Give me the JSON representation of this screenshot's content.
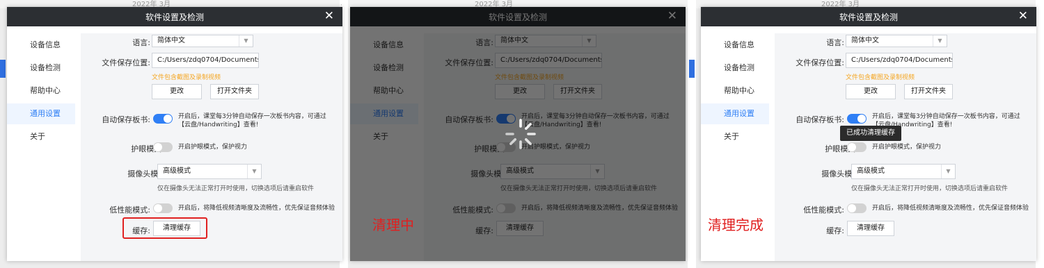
{
  "background": {
    "date_text": "2022年 3月"
  },
  "dialog": {
    "title": "软件设置及检测",
    "close_glyph": "✕",
    "nav": [
      {
        "label": "设备信息"
      },
      {
        "label": "设备检测"
      },
      {
        "label": "帮助中心"
      },
      {
        "label": "通用设置",
        "active": true
      },
      {
        "label": "关于"
      }
    ],
    "settings": {
      "language": {
        "label": "语言:",
        "value": "简体中文"
      },
      "save_path": {
        "label": "文件保存位置:",
        "value": "C:/Users/zdq0704/Documents/...",
        "note": "文件包含截图及录制视频",
        "change_button": "更改",
        "open_folder_button": "打开文件夹"
      },
      "autosave": {
        "label": "自动保存板书:",
        "enabled": true,
        "description": "开启后，课堂每3分钟自动保存一次板书内容，可通过【云盘/Handwriting】查看!"
      },
      "eye_care": {
        "label": "护眼模式:",
        "enabled": false,
        "description": "开启护眼模式，保护视力"
      },
      "camera_mode": {
        "label": "摄像头模式:",
        "value": "高级模式",
        "note": "仅在摄像头无法正常打开时使用，切换选项后请重启软件"
      },
      "low_perf": {
        "label": "低性能模式:",
        "enabled": false,
        "description": "开启后，将降低视频清晰度及流畅性，优先保证音频体验"
      },
      "cache": {
        "label": "缓存:",
        "clear_button": "清理缓存"
      }
    }
  },
  "panels": [
    {
      "state": "default"
    },
    {
      "state": "clearing",
      "caption": "清理中"
    },
    {
      "state": "done",
      "caption": "清理完成",
      "toast": "已成功清理缓存"
    }
  ],
  "colors": {
    "accent": "#2f7ff5",
    "note_orange": "#f5a623",
    "highlight_red": "#e02020",
    "titlebar": "#2c2f33"
  }
}
